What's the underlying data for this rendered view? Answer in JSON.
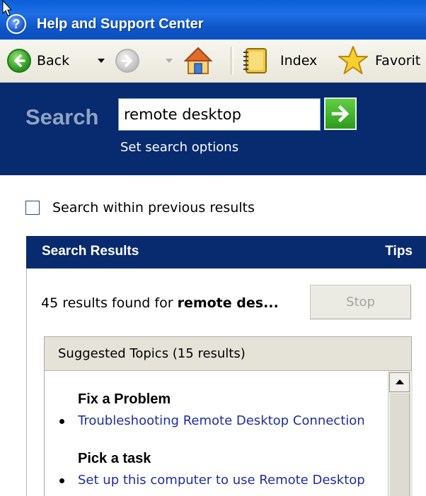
{
  "window": {
    "title": "Help and Support Center",
    "icon": "help-question-icon"
  },
  "toolbar": {
    "back_label": "Back",
    "index_label": "Index",
    "favorites_label": "Favorit",
    "icons": [
      "back-arrow-icon",
      "forward-arrow-icon",
      "home-icon",
      "index-book-icon",
      "favorites-star-icon"
    ]
  },
  "search": {
    "heading": "Search",
    "query_value": "remote desktop",
    "options_link": "Set search options",
    "go_icon": "go-arrow-icon"
  },
  "filter": {
    "within_previous_label": "Search within previous results",
    "within_previous_checked": false
  },
  "results": {
    "header_title": "Search Results",
    "tips_label": "Tips",
    "summary_prefix": "45 results found for ",
    "summary_query": "remote des...",
    "stop_label": "Stop",
    "topics_header": "Suggested Topics (15 results)",
    "sections": [
      {
        "heading": "Fix a Problem",
        "links": [
          "Troubleshooting Remote Desktop Connection"
        ]
      },
      {
        "heading": "Pick a task",
        "links": [
          "Set up this computer to use Remote Desktop"
        ]
      }
    ]
  },
  "colors": {
    "titlebar_blue": "#0e56c8",
    "search_band_navy": "#082a6e",
    "link_blue": "#1f2d9e",
    "go_green": "#2e9b1f"
  }
}
